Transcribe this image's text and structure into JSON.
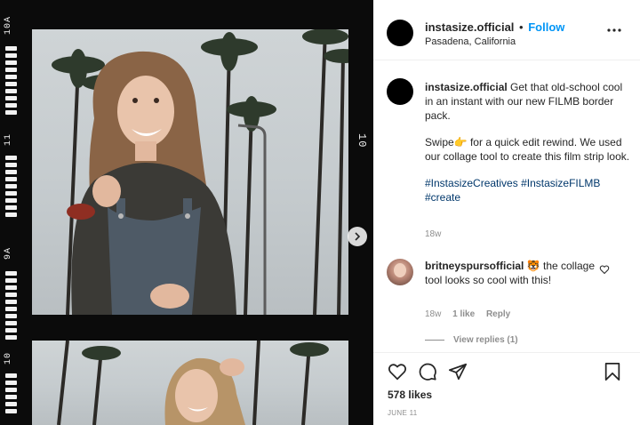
{
  "header": {
    "username": "instasize.official",
    "separator": "•",
    "follow_label": "Follow",
    "location": "Pasadena, California"
  },
  "media": {
    "edge_labels": [
      "10A",
      "11",
      "9A",
      "10"
    ],
    "frame_label": "10",
    "next_icon": "chevron-right-icon"
  },
  "caption": {
    "username": "instasize.official",
    "line1": "Get that old-school cool in an instant with our new FILMB border pack.",
    "line2_a": "Swipe",
    "line2_emoji": "👉",
    "line2_b": " for a quick edit rewind. We used our collage tool to create this film strip look.",
    "hashtag1": "#InstasizeCreatives",
    "hashtag2": "#InstasizeFILMB",
    "hashtag3": "#create",
    "age": "18w"
  },
  "comment": {
    "username": "britneyspursofficial",
    "emoji": "🐯",
    "text": " the collage tool looks so cool with this!",
    "age": "18w",
    "likes": "1 like",
    "reply_label": "Reply",
    "view_replies": "View replies (1)"
  },
  "actions": {
    "likes": "578 likes",
    "date": "JUNE 11",
    "icons": [
      "heart-icon",
      "comment-icon",
      "share-icon",
      "bookmark-icon"
    ]
  },
  "colors": {
    "follow": "#0095f6",
    "hashtag": "#00376b",
    "muted": "#8e8e8e",
    "film": "#0b0b0b"
  }
}
